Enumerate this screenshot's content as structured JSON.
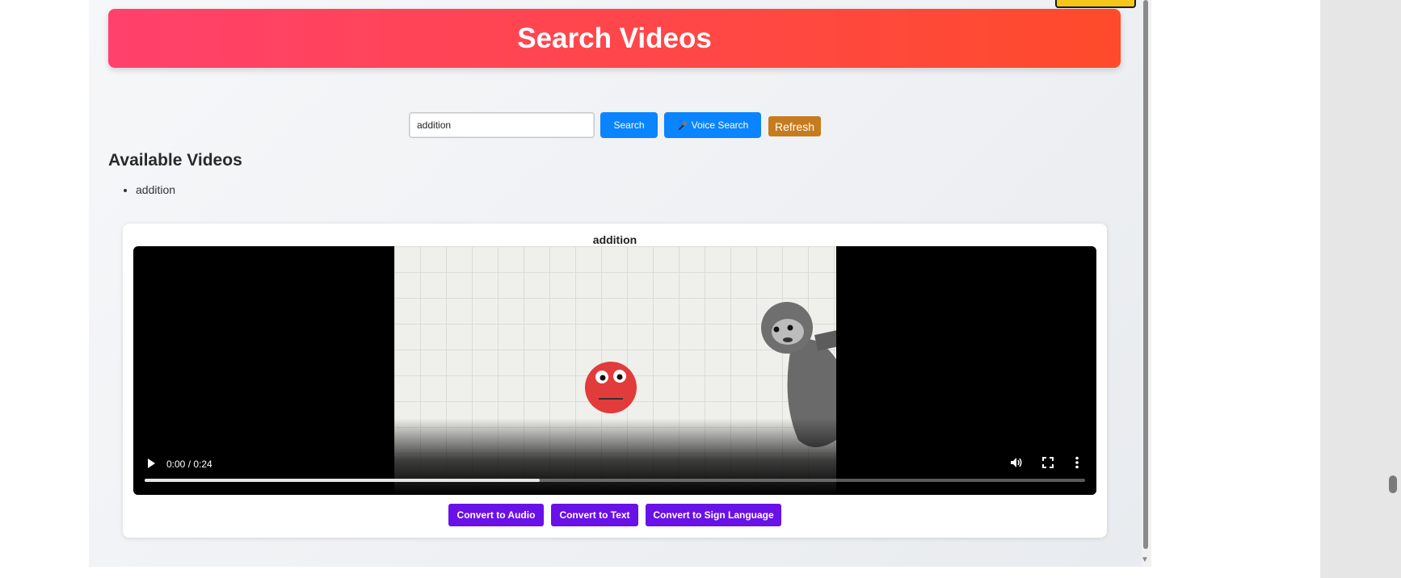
{
  "header": {
    "title": "Search Videos"
  },
  "search": {
    "value": "addition",
    "search_label": "Search",
    "voice_label": "Voice Search",
    "refresh_label": "Refresh"
  },
  "available": {
    "heading": "Available Videos",
    "items": [
      "addition"
    ]
  },
  "video": {
    "title": "addition",
    "time": "0:00 / 0:24",
    "progress_fraction": 0.42,
    "icons": [
      "play-icon",
      "volume-icon",
      "fullscreen-icon",
      "more-icon"
    ]
  },
  "actions": {
    "audio_label": "Convert to Audio",
    "text_label": "Convert to Text",
    "sign_label": "Convert to Sign Language"
  },
  "colors": {
    "banner_start": "#ff416c",
    "banner_end": "#ff4b2b",
    "primary_blue": "#0a84ff",
    "refresh": "#c67c1e",
    "convert_purple": "#6a11e8"
  }
}
